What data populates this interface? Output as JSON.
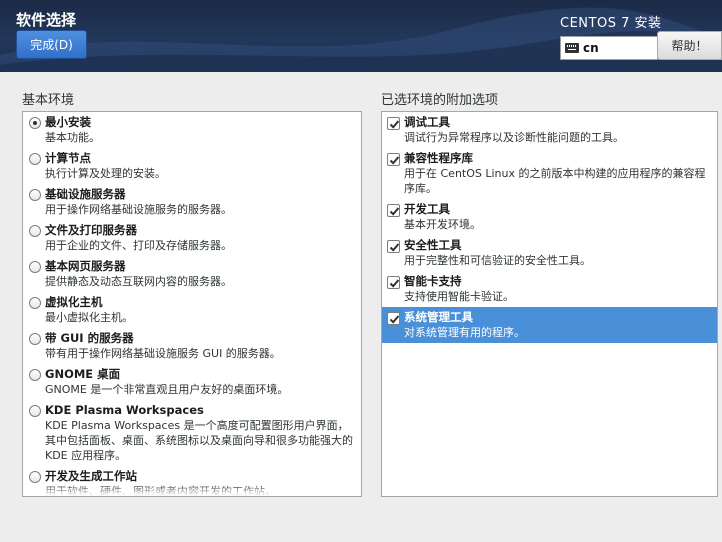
{
  "header": {
    "page_title": "软件选择",
    "done_label": "完成(D)",
    "product_title": "CENTOS 7 安装",
    "keyboard_layout": "cn",
    "help_label": "帮助！"
  },
  "base_environment": {
    "label": "基本环境",
    "selected_index": 0,
    "items": [
      {
        "name": "最小安装",
        "desc": "基本功能。",
        "checked": true
      },
      {
        "name": "计算节点",
        "desc": "执行计算及处理的安装。",
        "checked": false
      },
      {
        "name": "基础设施服务器",
        "desc": "用于操作网络基础设施服务的服务器。",
        "checked": false
      },
      {
        "name": "文件及打印服务器",
        "desc": "用于企业的文件、打印及存储服务器。",
        "checked": false
      },
      {
        "name": "基本网页服务器",
        "desc": "提供静态及动态互联网内容的服务器。",
        "checked": false
      },
      {
        "name": "虚拟化主机",
        "desc": "最小虚拟化主机。",
        "checked": false
      },
      {
        "name": "带 GUI 的服务器",
        "desc": "带有用于操作网络基础设施服务 GUI 的服务器。",
        "checked": false
      },
      {
        "name": "GNOME 桌面",
        "desc": "GNOME 是一个非常直观且用户友好的桌面环境。",
        "checked": false
      },
      {
        "name": "KDE Plasma Workspaces",
        "desc": "KDE Plasma Workspaces 是一个高度可配置图形用户界面，其中包括面板、桌面、系统图标以及桌面向导和很多功能强大的 KDE 应用程序。",
        "checked": false
      },
      {
        "name": "开发及生成工作站",
        "desc": "用于软件、硬件、图形或者内容开发的工作站。",
        "checked": false
      }
    ]
  },
  "addons": {
    "label": "已选环境的附加选项",
    "items": [
      {
        "name": "调试工具",
        "desc": "调试行为异常程序以及诊断性能问题的工具。",
        "checked": true,
        "selected": false
      },
      {
        "name": "兼容性程序库",
        "desc": "用于在 CentOS Linux 的之前版本中构建的应用程序的兼容程序库。",
        "checked": true,
        "selected": false
      },
      {
        "name": "开发工具",
        "desc": "基本开发环境。",
        "checked": true,
        "selected": false
      },
      {
        "name": "安全性工具",
        "desc": "用于完整性和可信验证的安全性工具。",
        "checked": true,
        "selected": false
      },
      {
        "name": "智能卡支持",
        "desc": "支持使用智能卡验证。",
        "checked": true,
        "selected": false
      },
      {
        "name": "系统管理工具",
        "desc": "对系统管理有用的程序。",
        "checked": true,
        "selected": true
      }
    ]
  },
  "colors": {
    "header_bg": "#22375a",
    "accent": "#3270c8",
    "selection": "#4a90d9"
  }
}
